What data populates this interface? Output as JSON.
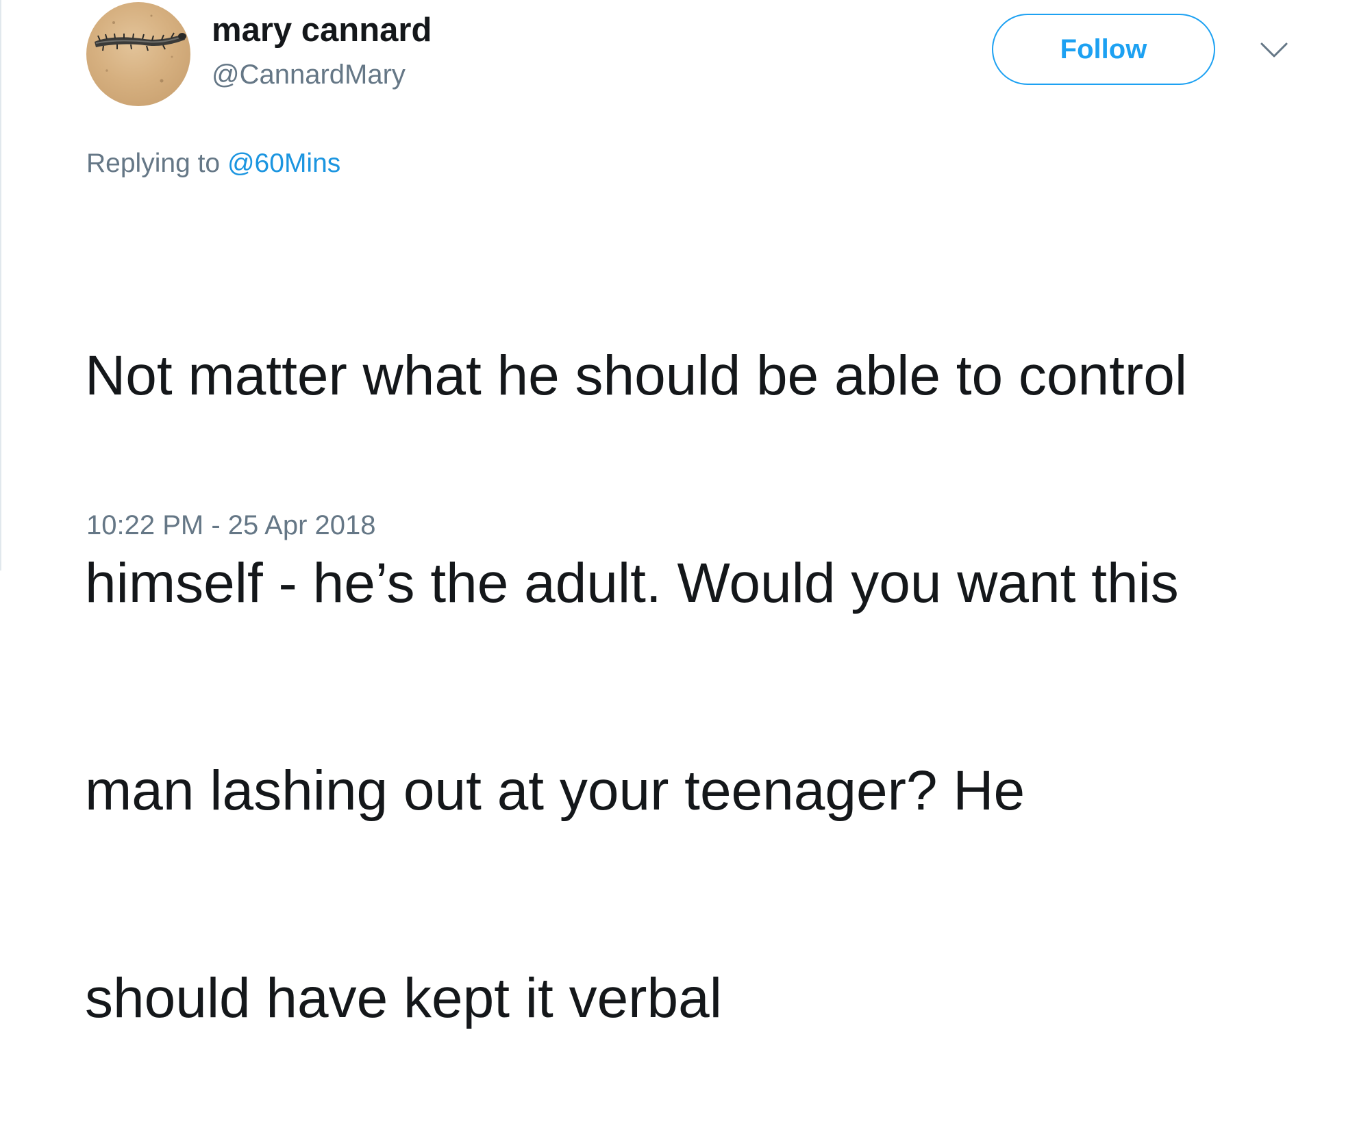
{
  "tweet": {
    "author": {
      "display_name": "mary cannard",
      "screen_name": "@CannardMary",
      "avatar": "caterpillar-photo-avatar"
    },
    "follow_label": "Follow",
    "more_icon": "chevron-down-icon",
    "reply_context": {
      "prefix": "Replying to",
      "mention": "@60Mins"
    },
    "text_lines": [
      "Not matter what he should be able to control",
      "himself - he’s the adult. Would you want this",
      "man lashing out at your teenager?  He",
      "should have kept it verbal"
    ],
    "timestamp": "10:22 PM - 25 Apr 2018"
  },
  "colors": {
    "accent": "#1da1f2",
    "mention": "#1b95e0",
    "secondary_text": "#657786",
    "primary_text": "#14171a",
    "border": "#e1e8ed"
  }
}
